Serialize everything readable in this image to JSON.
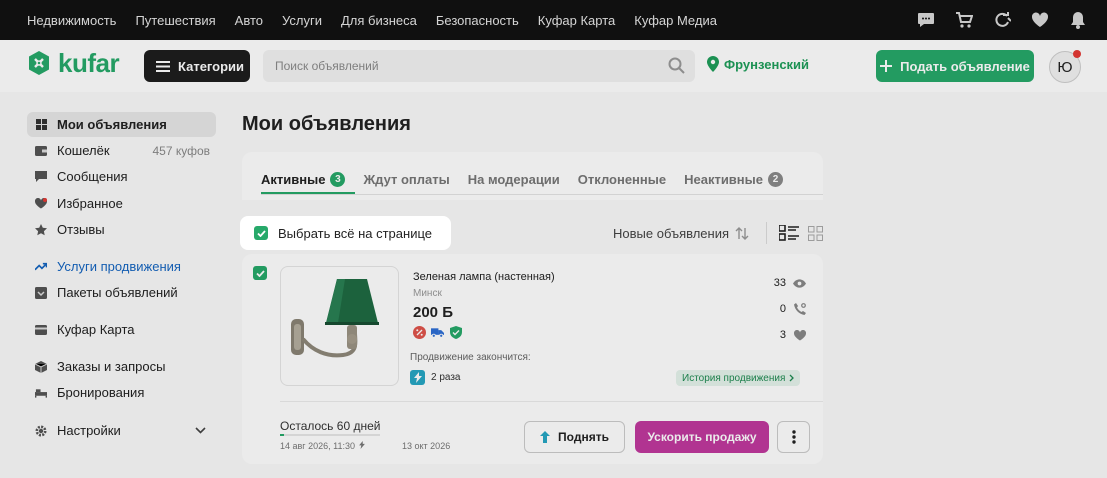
{
  "topnav": {
    "links": [
      "Недвижимость",
      "Путешествия",
      "Авто",
      "Услуги",
      "Для бизнеса",
      "Безопасность",
      "Куфар Карта",
      "Куфар Медиа"
    ],
    "icons": [
      "chat-icon",
      "cart-icon",
      "compare-icon",
      "heart-icon",
      "bell-icon"
    ]
  },
  "header": {
    "logo_text": "kufar",
    "categories_label": "Категории",
    "search_placeholder": "Поиск объявлений",
    "location": "Фрунзенский",
    "post_label": "Подать объявление",
    "avatar_letter": "Ю"
  },
  "sidebar": {
    "items": [
      {
        "label": "Мои объявления",
        "icon": "grid-icon",
        "active": true
      },
      {
        "label": "Кошелёк",
        "icon": "wallet-icon",
        "extra": "457 куфов"
      },
      {
        "label": "Сообщения",
        "icon": "message-icon"
      },
      {
        "label": "Избранное",
        "icon": "heart-icon"
      },
      {
        "label": "Отзывы",
        "icon": "star-icon"
      },
      {
        "label": "Услуги продвижения",
        "icon": "trend-up-icon"
      },
      {
        "label": "Пакеты объявлений",
        "icon": "package-icon"
      },
      {
        "label": "Куфар Карта",
        "icon": "card-icon"
      },
      {
        "label": "Заказы и запросы",
        "icon": "box-icon"
      },
      {
        "label": "Бронирования",
        "icon": "bed-icon"
      },
      {
        "label": "Настройки",
        "icon": "gear-icon"
      }
    ]
  },
  "main": {
    "title": "Мои объявления",
    "tabs": [
      {
        "label": "Активные",
        "count": "3"
      },
      {
        "label": "Ждут оплаты",
        "count": ""
      },
      {
        "label": "На модерации",
        "count": ""
      },
      {
        "label": "Отклоненные",
        "count": ""
      },
      {
        "label": "Неактивные",
        "count": "2"
      }
    ],
    "select_all": "Выбрать всё на странице",
    "sort_label": "Новые объявления"
  },
  "listing": {
    "title": "Зеленая лампа (настенная)",
    "city": "Минск",
    "price": "200 Б",
    "promo_label": "Продвижение закончится:",
    "boost_count": "2 раза",
    "history_label": "История продвижения",
    "views": "33",
    "calls": "0",
    "favorites": "3",
    "remaining": "Осталось 60 дней",
    "remaining_fraction": 0.04,
    "date_start": "14 авг 2026, 11:30",
    "date_end": "13 окт 2026",
    "raise_label": "Поднять",
    "speed_label": "Ускорить продажу"
  },
  "colors": {
    "brand_green": "#27a96a",
    "speed_magenta": "#c0399e",
    "promo_blue": "#1565c0"
  }
}
